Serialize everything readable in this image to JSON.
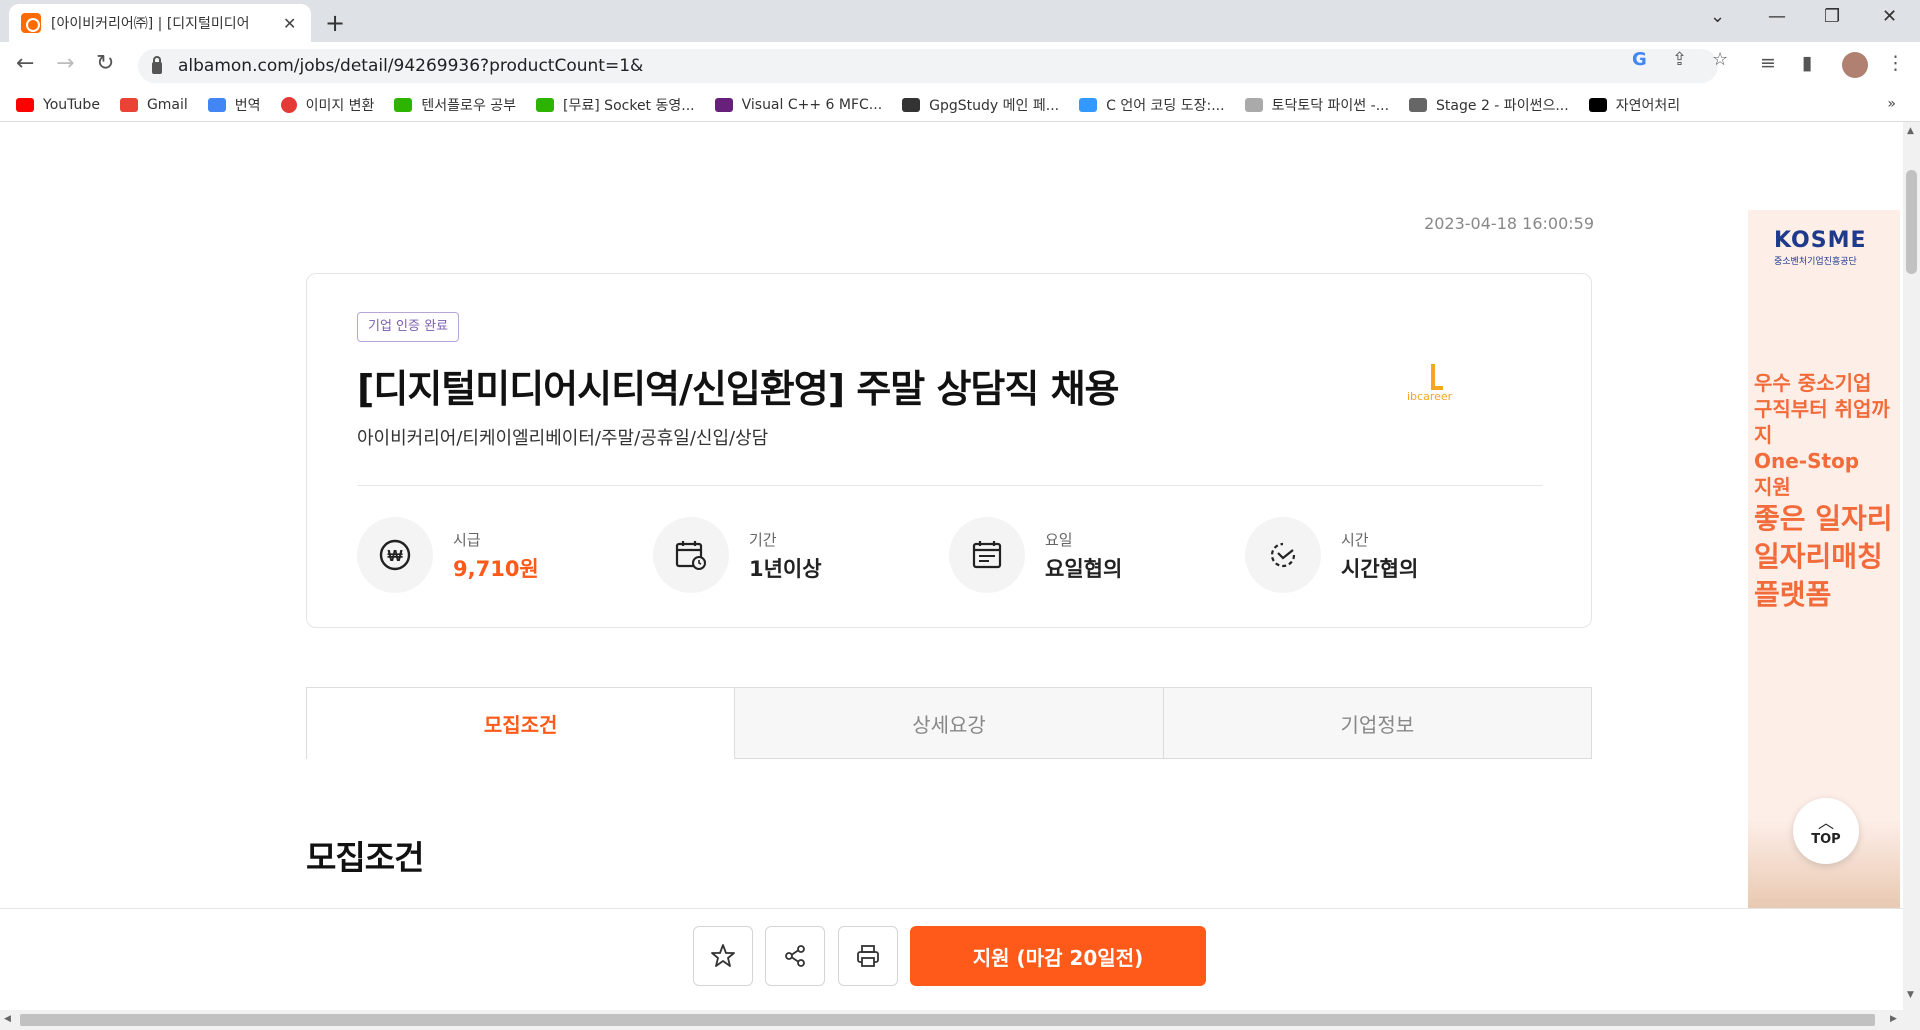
{
  "browser": {
    "tab_title": "[아이비커리어㈜] | [디지털미디어",
    "tab_close": "✕",
    "new_tab": "+",
    "url": "albamon.com/jobs/detail/94269936?productCount=1&",
    "window_controls": {
      "chevron": "⌄",
      "minimize": "—",
      "restore": "❐",
      "close": "✕"
    },
    "bookmarks": [
      {
        "label": "YouTube",
        "color": "#ff0000"
      },
      {
        "label": "Gmail",
        "color": "#ea4335"
      },
      {
        "label": "번역",
        "color": "#4285f4"
      },
      {
        "label": "이미지 변환",
        "color": "#e53935"
      },
      {
        "label": "텐서플로우 공부",
        "color": "#2db400"
      },
      {
        "label": "[무료] Socket 동영...",
        "color": "#2db400"
      },
      {
        "label": "Visual C++ 6 MFC...",
        "color": "#68217a"
      },
      {
        "label": "GpgStudy 메인 페...",
        "color": "#333333"
      },
      {
        "label": "C 언어 코딩 도장:...",
        "color": "#3399ff"
      },
      {
        "label": "토닥토닥 파이썬 -...",
        "color": "#888888"
      },
      {
        "label": "Stage 2 - 파이썬으...",
        "color": "#666666"
      },
      {
        "label": "자연어처리",
        "color": "#000000"
      }
    ],
    "bookmarks_more": "»"
  },
  "page": {
    "posted_at": "2023-04-18 16:00:59",
    "badge": "기업 인증 완료",
    "job_title": "[디지털미디어시티역/신입환영] 주말 상담직 채용",
    "company": "아이비커리어/티케이엘리베이터/주말/공휴일/신입/상담",
    "logo_text": "ibcareer",
    "info": [
      {
        "label": "시급",
        "value": "9,710원",
        "icon": "won-icon"
      },
      {
        "label": "기간",
        "value": "1년이상",
        "icon": "calendar-clock-icon"
      },
      {
        "label": "요일",
        "value": "요일협의",
        "icon": "calendar-icon"
      },
      {
        "label": "시간",
        "value": "시간협의",
        "icon": "clock-icon"
      }
    ],
    "tabs": [
      "모집조건",
      "상세요강",
      "기업정보"
    ],
    "active_tab": 0,
    "section_title": "모집조건",
    "apply_button": "지원  (마감 20일전)",
    "top_button": "TOP",
    "top_arrow": "︿"
  },
  "ad": {
    "logo": "KOSME",
    "sub": "중소벤처기업진흥공단",
    "line1": [
      "우수 중소기업",
      "구직부터 취업까지",
      "One-Stop",
      "지원"
    ],
    "line2": [
      "좋은 일자리",
      "일자리매칭",
      "플랫폼"
    ]
  },
  "colors": {
    "accent": "#ff5a1a",
    "badge": "#7a5fb1"
  }
}
